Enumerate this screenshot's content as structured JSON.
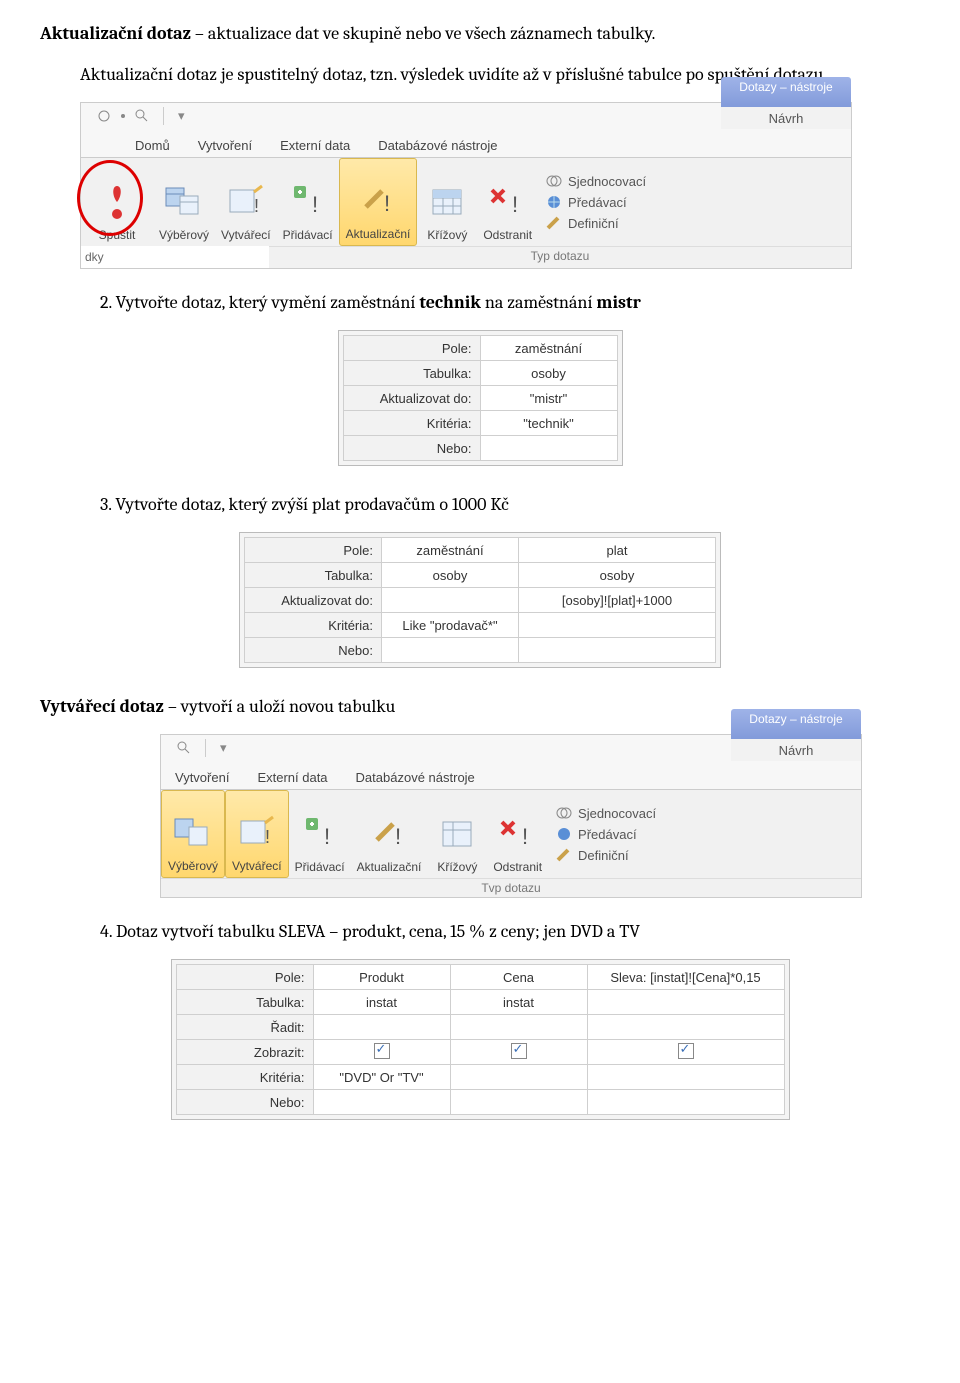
{
  "text": {
    "title_bold": "Aktualizační dotaz",
    "title_rest": " – aktualizace dat ve skupině nebo ve všech záznamech tabulky.",
    "p1": "Aktualizační dotaz je spustitelný dotaz, tzn. výsledek uvidíte až v příslušné tabulce po spuštění dotazu",
    "n2a": "2. Vytvořte dotaz, který vymění zaměstnání ",
    "n2b": "technik",
    "n2c": " na zaměstnání ",
    "n2d": "mistr",
    "n3": "3. Vytvořte dotaz, který zvýší plat prodavačům o 1000 Kč",
    "h2a": "Vytvářecí dotaz",
    "h2b": " – vytvoří a uloží novou tabulku",
    "n4": "4. Dotaz vytvoří tabulku SLEVA – produkt, cena, 15 % z ceny; jen DVD a TV"
  },
  "ribbon": {
    "context_title": "Dotazy – nástroje",
    "tabs": [
      "Domů",
      "Vytvoření",
      "Externí data",
      "Databázové nástroje",
      "Návrh"
    ],
    "buttons": [
      "Spustit",
      "Výběrový",
      "Vytvářecí",
      "Přidávací",
      "Aktualizační",
      "Křížový",
      "Odstranit"
    ],
    "side": [
      "Sjednocovací",
      "Předávací",
      "Definiční"
    ],
    "group_label": "Typ dotazu",
    "btm_left": "dky"
  },
  "ribbon2": {
    "tabs": [
      "Vytvoření",
      "Externí data",
      "Databázové nástroje",
      "Návrh"
    ],
    "buttons": [
      "Výběrový",
      "Vytvářecí",
      "Přidávací",
      "Aktualizační",
      "Křížový",
      "Odstranit"
    ],
    "side": [
      "Sjednocovací",
      "Předávací",
      "Definiční"
    ],
    "group_label": "Tvp dotazu"
  },
  "grid1": {
    "rows": [
      "Pole:",
      "Tabulka:",
      "Aktualizovat do:",
      "Kritéria:",
      "Nebo:"
    ],
    "vals": [
      "zaměstnání",
      "osoby",
      "\"mistr\"",
      "\"technik\"",
      ""
    ]
  },
  "grid2": {
    "rows": [
      "Pole:",
      "Tabulka:",
      "Aktualizovat do:",
      "Kritéria:",
      "Nebo:"
    ],
    "c1": [
      "zaměstnání",
      "osoby",
      "",
      "Like \"prodavač*\"",
      ""
    ],
    "c2": [
      "plat",
      "osoby",
      "[osoby]![plat]+1000",
      "",
      ""
    ]
  },
  "grid3": {
    "rows": [
      "Pole:",
      "Tabulka:",
      "Řadit:",
      "Zobrazit:",
      "Kritéria:",
      "Nebo:"
    ],
    "c1": [
      "Produkt",
      "instat",
      "",
      "chk",
      "\"DVD\" Or \"TV\"",
      ""
    ],
    "c2": [
      "Cena",
      "instat",
      "",
      "chk",
      "",
      ""
    ],
    "c3": [
      "Sleva: [instat]![Cena]*0,15",
      "",
      "",
      "chk",
      "",
      ""
    ]
  }
}
